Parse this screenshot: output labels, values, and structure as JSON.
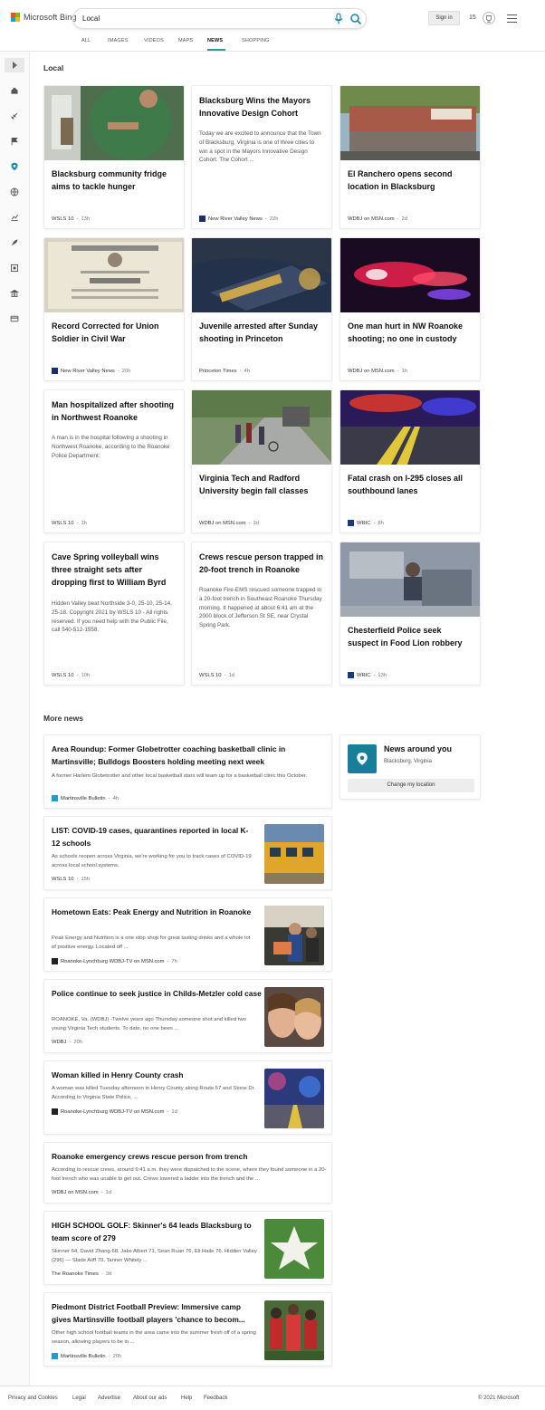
{
  "header": {
    "logo_text": "Microsoft Bing",
    "search_value": "Local",
    "signin_label": "Sign in",
    "rewards_count": "15",
    "colors": {
      "accent": "#1e9fb2",
      "logo": [
        "#f25022",
        "#7fba00",
        "#00a4ef",
        "#ffb900"
      ]
    }
  },
  "tabs": [
    "ALL",
    "IMAGES",
    "VIDEOS",
    "MAPS",
    "NEWS",
    "SHOPPING"
  ],
  "active_tab": "NEWS",
  "rail_icons": [
    "expand-icon",
    "home-icon",
    "satellite-icon",
    "flag-icon",
    "location-pin-icon",
    "globe-icon",
    "chart-icon",
    "rocket-icon",
    "film-icon",
    "building-icon",
    "card-icon"
  ],
  "local": {
    "title": "Local",
    "cards": [
      {
        "title": "Blacksburg community fridge aims to tackle hunger",
        "snippet": "",
        "source": "WSLS 10",
        "age": "13h"
      },
      {
        "title": "Blacksburg Wins the Mayors Innovative Design Cohort",
        "snippet": "Today we are excited to announce that the Town of Blacksburg, Virginia is one of three cities to win a spot in the Mayors Innovative Design Cohort. The Cohort ...",
        "source": "New River Valley News",
        "age": "22h"
      },
      {
        "title": "El Ranchero opens second location in Blacksburg",
        "snippet": "",
        "source": "WDBJ on MSN.com",
        "age": "2d"
      },
      {
        "title": "Record Corrected for Union Soldier in Civil War",
        "snippet": "",
        "source": "New River Valley News",
        "age": "20h"
      },
      {
        "title": "Juvenile arrested after Sunday shooting in Princeton",
        "snippet": "",
        "source": "Princeton Times",
        "age": "4h"
      },
      {
        "title": "One man hurt in NW Roanoke shooting; no one in custody",
        "snippet": "",
        "source": "WDBJ on MSN.com",
        "age": "1h"
      },
      {
        "title": "Man hospitalized after shooting in Northwest Roanoke",
        "snippet": "A man is in the hospital following a shooting in Northwest Roanoke, according to the Roanoke Police Department.",
        "source": "WSLS 10",
        "age": "1h"
      },
      {
        "title": "Virginia Tech and Radford University begin fall classes",
        "snippet": "",
        "source": "WDBJ on MSN.com",
        "age": "3d"
      },
      {
        "title": "Fatal crash on I-295 closes all southbound lanes",
        "snippet": "",
        "source": "WRIC",
        "age": "8h"
      },
      {
        "title": "Cave Spring volleyball wins three straight sets after dropping first to William Byrd",
        "snippet": "Hidden Valley beat Northside 3-0, 25-10, 25-14, 25-18. Copyright 2021 by WSLS 10 - All rights reserved. If you need help with the Public File, call 540-512-1558.",
        "source": "WSLS 10",
        "age": "10h"
      },
      {
        "title": "Crews rescue person trapped in 20-foot trench in Roanoke",
        "snippet": "Roanoke Fire-EMS rescued someone trapped in a 20-foot trench in Southeast Roanoke Thursday morning. It happened at about 6:41 am at the 2000 block of Jefferson St SE, near Crystal Spring Park.",
        "source": "WSLS 10",
        "age": "1d"
      },
      {
        "title": "Chesterfield Police seek suspect in Food Lion robbery",
        "snippet": "",
        "source": "WRIC",
        "age": "13h"
      }
    ]
  },
  "more_news": {
    "title": "More news",
    "items": [
      {
        "title": "Area Roundup: Former Globetrotter coaching basketball clinic in Martinsville; Bulldogs Boosters holding meeting next week",
        "snippet": "A former Harlem Globetrotter and other local basketball stars will team up for a basketball clinic this October.",
        "source": "Martinsville Bulletin",
        "age": "4h"
      },
      {
        "title": "LIST: COVID-19 cases, quarantines reported in local K-12 schools",
        "snippet": "As schools reopen across Virginia, we're working for you to track cases of COVID-19 across local school systems.",
        "source": "WSLS 10",
        "age": "15h"
      },
      {
        "title": "Hometown Eats: Peak Energy and Nutrition in Roanoke",
        "snippet": "Peak Energy and Nutrition is a one stop shop for great tasting drinks and a whole lot of positive energy. Located off ...",
        "source": "Roanoke-Lynchburg WDBJ-TV on MSN.com",
        "age": "7h"
      },
      {
        "title": "Police continue to seek justice in Childs-Metzler cold case",
        "snippet": "ROANOKE, Va. (WDBJ) -Twelve years ago Thursday someone shot and killed two young Virginia Tech students. To date, no one been ...",
        "source": "WDBJ",
        "age": "20h"
      },
      {
        "title": "Woman killed in Henry County crash",
        "snippet": "A woman was killed Tuesday afternoon in Henry County along Route 57 and Stone Dr. According to Virginia State Police, ...",
        "source": "Roanoke-Lynchburg WDBJ-TV on MSN.com",
        "age": "1d"
      },
      {
        "title": "Roanoke emergency crews rescue person from trench",
        "snippet": "According to rescue crews, around 6:41 a.m. they were dispatched to the scene, where they found someone in a 20-foot trench who was unable to get out. Crews lowered a ladder into the trench and the ...",
        "source": "WDBJ on MSN.com",
        "age": "1d"
      },
      {
        "title": "HIGH SCHOOL GOLF: Skinner's 64 leads Blacksburg to team score of 279",
        "snippet": "Skinner 64, David Zhang 68, Jake Albert 71, Sean Ruan 76, Eli Haile 76. Hidden Valley (296) — Slade Aliff 70, Tanner Whitely ...",
        "source": "The Roanoke Times",
        "age": "3d"
      },
      {
        "title": "Piedmont District Football Preview: Immersive camp gives Martinsville football players 'chance to becom...",
        "snippet": "Other high school football teams in the area came into the summer fresh off of a spring season, allowing players to be in ...",
        "source": "Martinsville Bulletin",
        "age": "20h"
      }
    ]
  },
  "news_around_you": {
    "title": "News around you",
    "location": "Blacksburg, Virginia",
    "button": "Change my location"
  },
  "footer": {
    "links": [
      "Privacy and Cookies",
      "Legal",
      "Advertise",
      "About our ads",
      "Help",
      "Feedback"
    ],
    "copyright": "© 2021 Microsoft"
  }
}
